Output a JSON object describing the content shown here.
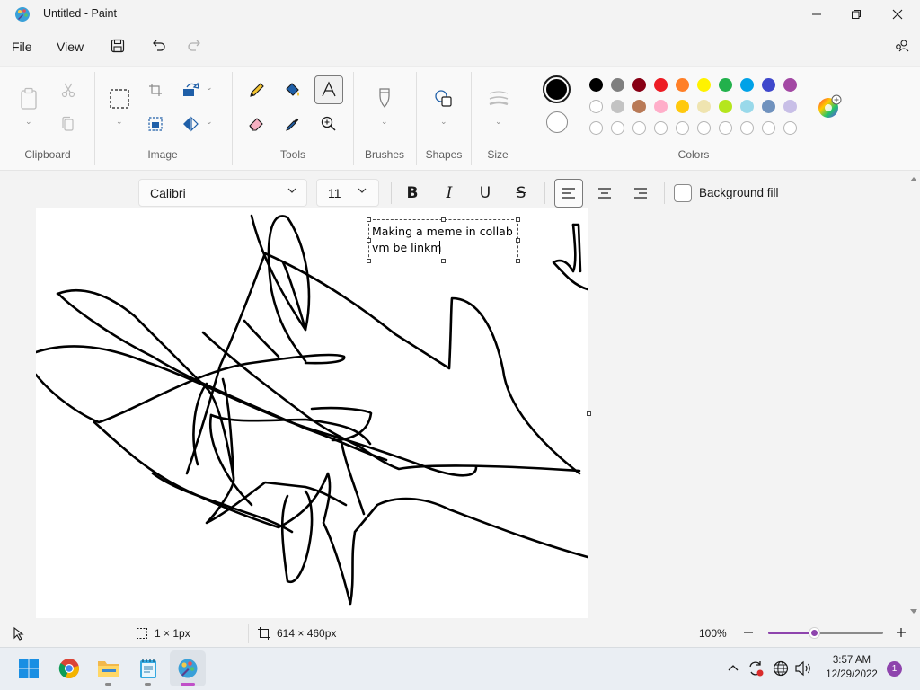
{
  "window": {
    "title": "Untitled - Paint"
  },
  "menu": {
    "file": "File",
    "view": "View"
  },
  "ribbon": {
    "groups": {
      "clipboard": "Clipboard",
      "image": "Image",
      "tools": "Tools",
      "brushes": "Brushes",
      "shapes": "Shapes",
      "size": "Size",
      "colors": "Colors"
    },
    "palette_row1": [
      "#000000",
      "#7f7f7f",
      "#880015",
      "#ed1c24",
      "#ff7f27",
      "#fff200",
      "#22b14c",
      "#00a2e8",
      "#3f48cc",
      "#a349a4"
    ],
    "palette_row2": [
      "#ffffff",
      "#c3c3c3",
      "#b97a57",
      "#ffaec9",
      "#ffc90e",
      "#efe4b0",
      "#b5e61d",
      "#99d9ea",
      "#7092be",
      "#c8bfe7"
    ],
    "primary_color": "#000000",
    "secondary_color": "#ffffff"
  },
  "text_toolbar": {
    "font": "Calibri",
    "size": "11",
    "bold_label": "B",
    "italic_label": "I",
    "underline_label": "U",
    "strike_label": "S",
    "background_fill": "Background fill"
  },
  "canvas": {
    "text_content": "Making a meme in collab\nvm be linkm"
  },
  "status": {
    "selection_size": "1 × 1px",
    "canvas_size": "614 × 460px",
    "zoom": "100%",
    "zoom_level_percent": 100
  },
  "taskbar": {
    "time": "3:57 AM",
    "date": "12/29/2022",
    "notification_count": "1",
    "icons": [
      "start-icon",
      "chrome-icon",
      "file-explorer-icon",
      "notepad-icon",
      "paint-icon"
    ]
  }
}
